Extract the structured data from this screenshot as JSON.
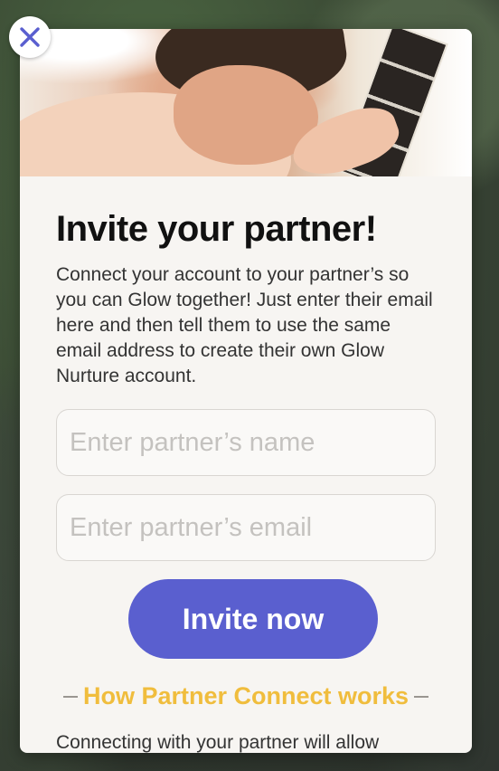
{
  "modal": {
    "title": "Invite your partner!",
    "description": "Connect your account to your partner’s so you can Glow together! Just enter their email here and then tell them to use the same email address to create their own Glow Nurture account.",
    "name_placeholder": "Enter partner’s name",
    "email_placeholder": "Enter partner’s email",
    "invite_button": "Invite now",
    "how_link": "How Partner Connect works",
    "peek_text": "Connecting with your partner will allow"
  },
  "icons": {
    "close": "close-icon"
  },
  "colors": {
    "accent": "#5a5fcf",
    "link": "#f0bd3d",
    "close_icon": "#5a5fcf"
  }
}
